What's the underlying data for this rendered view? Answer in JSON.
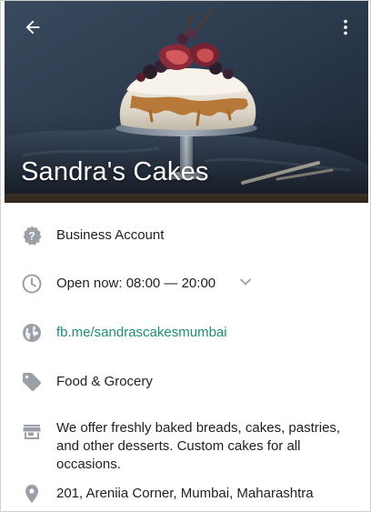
{
  "header": {
    "business_name": "Sandra's Cakes",
    "back_icon": "arrow-left-icon",
    "more_icon": "more-vertical-icon"
  },
  "info": {
    "account_type": {
      "icon": "question-badge-icon",
      "label": "Business Account"
    },
    "hours": {
      "icon": "clock-icon",
      "label": "Open now: 08:00 — 20:00",
      "expand_icon": "chevron-down-icon"
    },
    "website": {
      "icon": "globe-icon",
      "label": "fb.me/sandrascakesmumbai"
    },
    "category": {
      "icon": "tag-icon",
      "label": "Food & Grocery"
    },
    "description": {
      "icon": "store-icon",
      "label": "We offer freshly baked breads, cakes, pastries, and other desserts. Custom cakes for all occasions."
    },
    "address": {
      "icon": "location-pin-icon",
      "label": "201, Areniia Corner, Mumbai, Maharashtra"
    }
  },
  "colors": {
    "icon_gray": "#9aa0a6",
    "link_green": "#1c8f75",
    "text_dark": "#1f1f1f"
  }
}
